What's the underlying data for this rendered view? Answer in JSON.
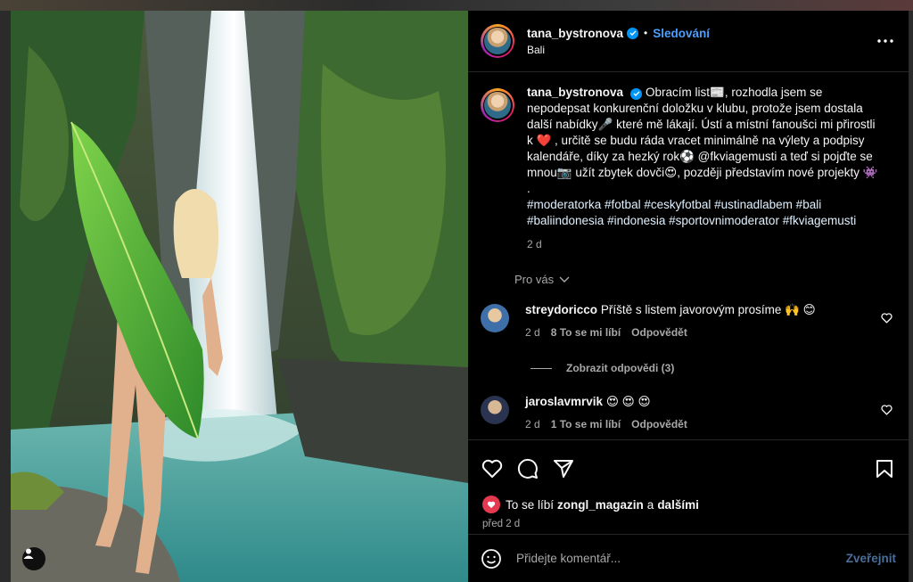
{
  "post": {
    "username": "tana_bystronova",
    "follow_label": "Sledování",
    "location": "Bali",
    "caption": "Obracím list📰, rozhodla jsem se nepodepsat konkurenční doložku v klubu, protože jsem dostala další nabídky🎤 které mě lákají. Ústí a místní fanoušci mi přirostli k ❤️ , určitě se budu ráda vracet minimálně na výlety a podpisy kalendáře, díky za hezký rok⚽ @fkviagemusti a teď si pojďte se mnou📷 užít zbytek dovči😍, později představím nové projekty 👾 .",
    "hashtags": "#moderatorka #fotbal #ceskyfotbal #ustinadlabem #bali #baliindonesia #indonesia #sportovnimoderator #fkviagemusti",
    "time": "2 d",
    "for_you_label": "Pro vás"
  },
  "comments": [
    {
      "username": "streydoricco",
      "text": "Příště s listem javorovým prosíme 🙌 😊",
      "time": "2 d",
      "likes": "8 To se mi líbí",
      "reply": "Odpovědět"
    },
    {
      "username": "jaroslavmrvik",
      "text": "😍 😍 😍",
      "time": "2 d",
      "likes": "1 To se mi líbí",
      "reply": "Odpovědět"
    }
  ],
  "view_replies": "Zobrazit odpovědi (3)",
  "likes_bar": {
    "prefix": "To se líbí",
    "user": "zongl_magazin",
    "joiner": "a",
    "others": "dalšími",
    "time_ago": "před 2 d"
  },
  "add_comment": {
    "placeholder": "Přidejte komentář...",
    "publish": "Zveřejnit"
  },
  "colors": {
    "accent": "#0095f6",
    "follow": "#4a9fff",
    "background": "#000000",
    "muted": "#a8a8a8"
  },
  "icons": [
    "more-icon",
    "verified-icon",
    "heart-icon",
    "comment-icon",
    "share-icon",
    "bookmark-icon",
    "emoji-icon",
    "user-tag-icon",
    "chevron-down-icon"
  ]
}
